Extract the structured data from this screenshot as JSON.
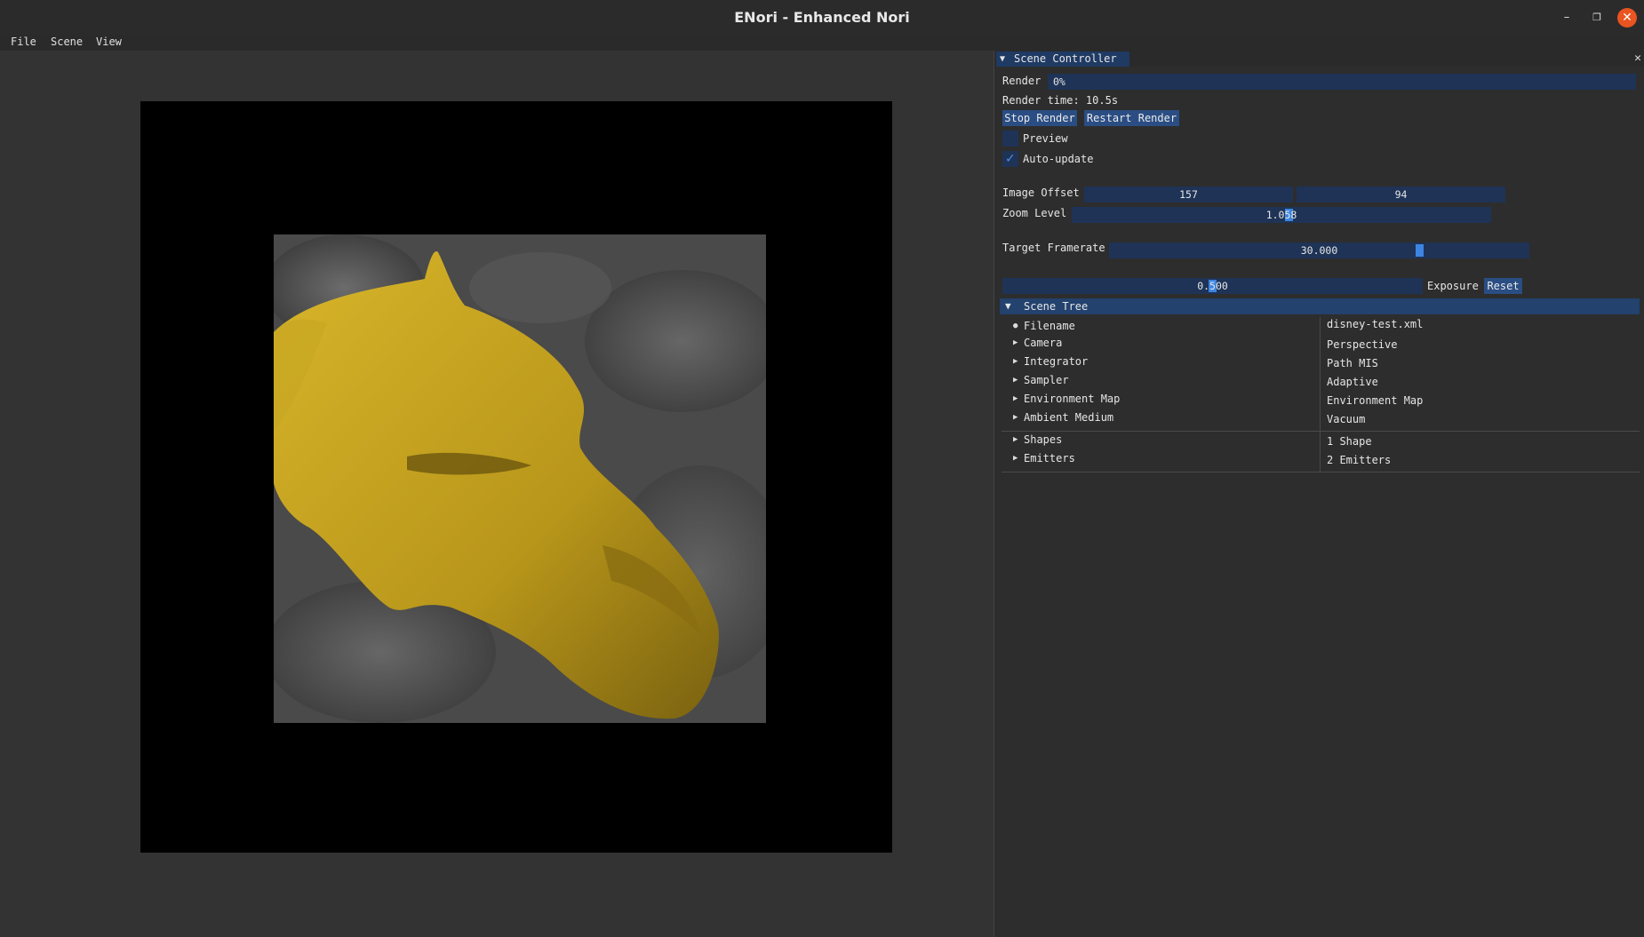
{
  "window": {
    "title": "ENori - Enhanced Nori"
  },
  "menu": {
    "file": "File",
    "scene": "Scene",
    "view": "View"
  },
  "panel": {
    "tab_label": "Scene Controller",
    "render_label": "Render",
    "render_progress": "0%",
    "render_time": "Render time: 10.5s",
    "stop_button": "Stop Render",
    "restart_button": "Restart Render",
    "preview_label": "Preview",
    "preview_checked": false,
    "autoupdate_label": "Auto-update",
    "autoupdate_checked": true,
    "image_offset_label": "Image Offset",
    "image_offset_x": "157",
    "image_offset_y": "94",
    "zoom_label": "Zoom Level",
    "zoom_value": "1.058",
    "framerate_label": "Target Framerate",
    "framerate_value": "30.000",
    "exposure_value": "0.500",
    "exposure_label": "Exposure",
    "reset_button": "Reset"
  },
  "scene_tree": {
    "header": "Scene Tree",
    "rows": [
      {
        "key": "Filename",
        "value": "disney-test.xml"
      },
      {
        "key": "Camera",
        "value": "Perspective"
      },
      {
        "key": "Integrator",
        "value": "Path MIS"
      },
      {
        "key": "Sampler",
        "value": "Adaptive"
      },
      {
        "key": "Environment Map",
        "value": "Environment Map"
      },
      {
        "key": "Ambient Medium",
        "value": "Vacuum"
      },
      {
        "key": "Shapes",
        "value": "1 Shape"
      },
      {
        "key": "Emitters",
        "value": "2 Emitters"
      }
    ]
  },
  "colors": {
    "accent": "#3d85e0",
    "field": "#1e3356",
    "button": "#2a4d83",
    "close": "#e95420",
    "object": "#c9a91c"
  },
  "icons": {
    "close": "close-icon",
    "minimize": "minimize-icon",
    "maximize": "maximize-icon",
    "checkbox": "check-icon"
  }
}
